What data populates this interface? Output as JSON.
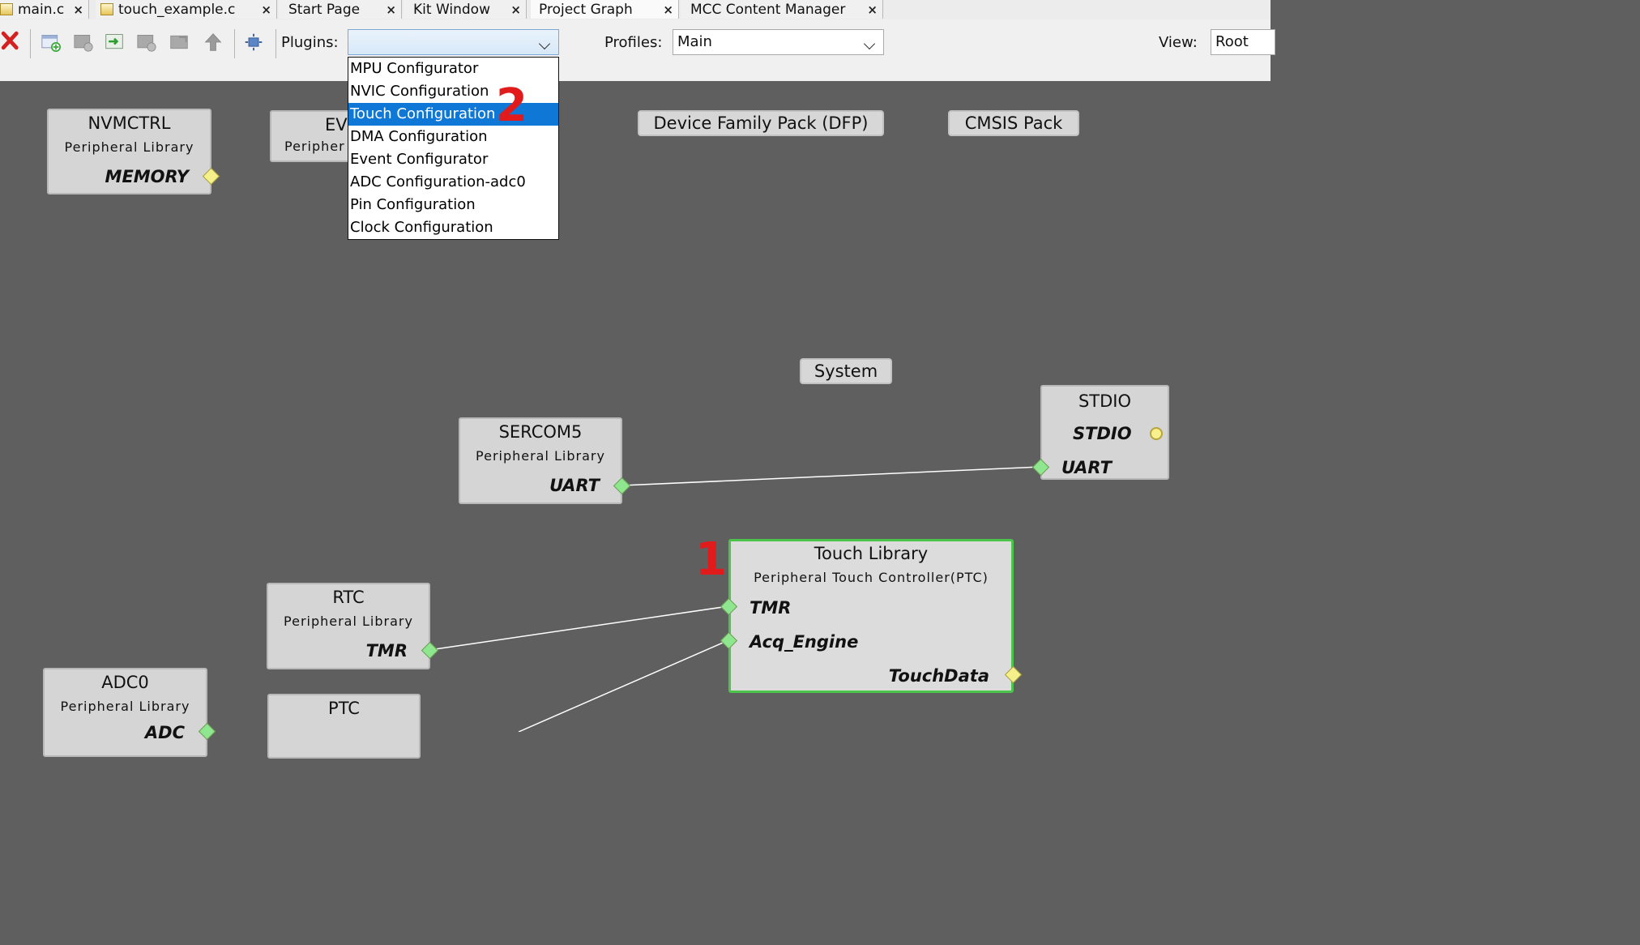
{
  "tabs": [
    {
      "label": "main.c"
    },
    {
      "label": "touch_example.c"
    },
    {
      "label": "Start Page"
    },
    {
      "label": "Kit Window"
    },
    {
      "label": "Project Graph"
    },
    {
      "label": "MCC Content Manager"
    }
  ],
  "toolbar": {
    "plugins_label": "Plugins:",
    "plugins_value": "",
    "profiles_label": "Profiles:",
    "profiles_value": "Main",
    "view_label": "View:",
    "view_value": "Root"
  },
  "plugins_menu": {
    "items": [
      "MPU Configurator",
      "NVIC Configuration",
      "Touch Configuration",
      "DMA Configuration",
      "Event Configurator",
      "ADC Configuration-adc0",
      "Pin Configuration",
      "Clock Configuration"
    ],
    "highlighted": "Touch Configuration"
  },
  "groups": {
    "dfp": "Device Family Pack (DFP)",
    "cmsis": "CMSIS Pack",
    "system": "System"
  },
  "nodes": {
    "nvmctrl": {
      "title": "NVMCTRL",
      "subtitle": "Peripheral Library",
      "port": "MEMORY"
    },
    "evsys": {
      "title": "EV",
      "subtitle": "Peripher"
    },
    "sercom5": {
      "title": "SERCOM5",
      "subtitle": "Peripheral Library",
      "port": "UART"
    },
    "stdio": {
      "title": "STDIO",
      "port1": "STDIO",
      "port2": "UART"
    },
    "rtc": {
      "title": "RTC",
      "subtitle": "Peripheral Library",
      "port": "TMR"
    },
    "touch": {
      "title": "Touch Library",
      "subtitle": "Peripheral Touch Controller(PTC)",
      "port_tmr": "TMR",
      "port_acq": "Acq_Engine",
      "port_data": "TouchData"
    },
    "adc0": {
      "title": "ADC0",
      "subtitle": "Peripheral Library",
      "port": "ADC"
    },
    "ptc": {
      "title": "PTC"
    }
  },
  "annotations": {
    "step1": "1",
    "step2": "2"
  },
  "colors": {
    "canvas": "#5f5f5f",
    "highlight": "#0f78d7",
    "selected_border": "#4cc44c",
    "step_marker": "#e11b1b"
  }
}
